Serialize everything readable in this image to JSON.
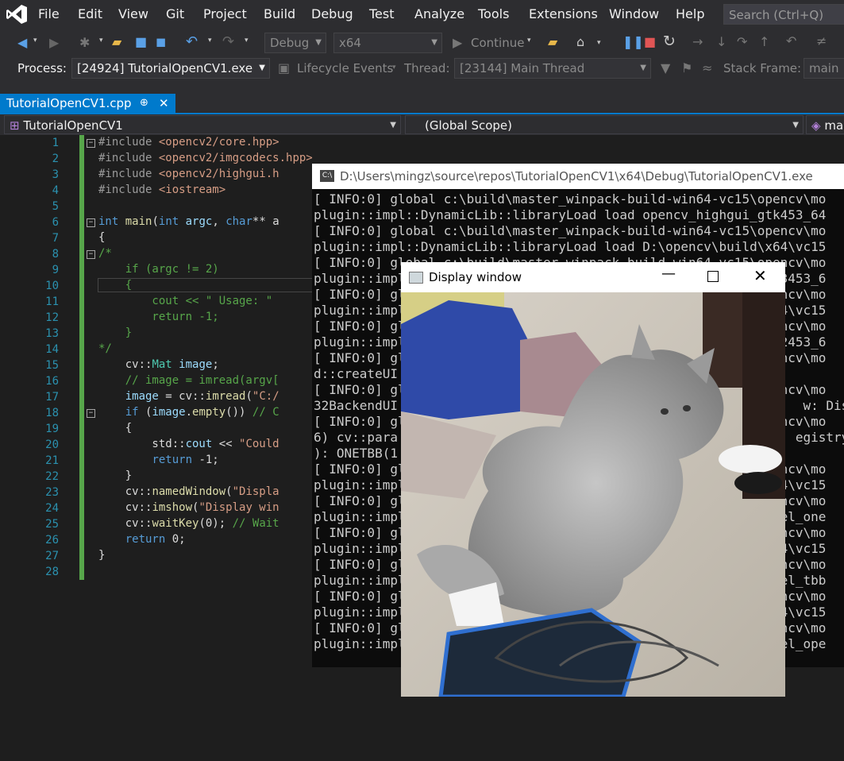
{
  "menubar": {
    "items": [
      "File",
      "Edit",
      "View",
      "Git",
      "Project",
      "Build",
      "Debug",
      "Test",
      "Analyze",
      "Tools",
      "Extensions",
      "Window",
      "Help"
    ],
    "search_placeholder": "Search (Ctrl+Q)"
  },
  "toolbar1": {
    "config": "Debug",
    "platform": "x64",
    "continue_label": "Continue"
  },
  "toolbar2": {
    "process_label": "Process:",
    "process_value": "[24924] TutorialOpenCV1.exe",
    "lifecycle_label": "Lifecycle Events",
    "thread_label": "Thread:",
    "thread_value": "[23144] Main Thread",
    "stackframe_label": "Stack Frame:",
    "stackframe_value": "main"
  },
  "tab": {
    "title": "TutorialOpenCV1.cpp",
    "pin": "⊕",
    "close": "✕"
  },
  "navbar": {
    "project": "TutorialOpenCV1",
    "scope": "(Global Scope)",
    "member": "ma"
  },
  "editor": {
    "line_numbers": [
      "1",
      "2",
      "3",
      "4",
      "5",
      "6",
      "7",
      "8",
      "9",
      "10",
      "11",
      "12",
      "13",
      "14",
      "15",
      "16",
      "17",
      "18",
      "19",
      "20",
      "21",
      "22",
      "23",
      "24",
      "25",
      "26",
      "27",
      "28"
    ]
  },
  "console": {
    "title": "D:\\Users\\mingz\\source\\repos\\TutorialOpenCV1\\x64\\Debug\\TutorialOpenCV1.exe",
    "lines": [
      "[ INFO:0] global c:\\build\\master_winpack-build-win64-vc15\\opencv\\mo",
      "plugin::impl::DynamicLib::libraryLoad load opencv_highgui_gtk453_64",
      "[ INFO:0] global c:\\build\\master_winpack-build-win64-vc15\\opencv\\mo",
      "plugin::impl::DynamicLib::libraryLoad load D:\\opencv\\build\\x64\\vc15",
      "[ INFO:0] global c:\\build\\master_winpack-build-win64-vc15\\opencv\\mo",
      "plugin::impl::DynamicLib::libraryLoad load opencv_highgui_gtk3453_6",
      "[ INFO:0] global c:\\build\\master_winpack-build-win64-vc15\\opencv\\mo",
      "plugin::impl::DynamicLib::libraryLoad load D:\\opencv\\build\\x64\\vc15",
      "[ INFO:0] global c:\\build\\master_winpack-build-win64-vc15\\opencv\\mo",
      "plugin::impl::DynamicLib::libraryLoad load opencv_highgui_gtk2453_6",
      "[ INFO:0] global c:\\build\\master_winpack-build-win64-vc15\\opencv\\mo",
      "d::createUI",
      "[ INFO:0] global c:\\build\\master_winpack-build-win64-vc15\\opencv\\mo",
      "32BackendUI                                                     w: Displ",
      "[ INFO:0] global c:\\build\\master_winpack-build-win64-vc15\\opencv\\mo",
      "6) cv::para                                                    egistry c",
      "): ONETBB(1",
      "[ INFO:0] global c:\\build\\master_winpack-build-win64-vc15\\opencv\\mo",
      "plugin::impl::DynamicLib::libraryLoad load D:\\opencv\\build\\x64\\vc15",
      "[ INFO:0] global c:\\build\\master_winpack-build-win64-vc15\\opencv\\mo",
      "plugin::impl::DynamicLib::libraryLoad load opencv_core_parallel_one",
      "[ INFO:0] global c:\\build\\master_winpack-build-win64-vc15\\opencv\\mo",
      "plugin::impl::DynamicLib::libraryLoad load D:\\opencv\\build\\x64\\vc15",
      "[ INFO:0] global c:\\build\\master_winpack-build-win64-vc15\\opencv\\mo",
      "plugin::impl::DynamicLib::libraryLoad load opencv_core_parallel_tbb",
      "[ INFO:0] global c:\\build\\master_winpack-build-win64-vc15\\opencv\\mo",
      "plugin::impl::DynamicLib::libraryLoad load D:\\opencv\\build\\x64\\vc15",
      "[ INFO:0] global c:\\build\\master_winpack-build-win64-vc15\\opencv\\mo",
      "plugin::impl::DynamicLib::libraryLoad load opencv_core_parallel_ope"
    ]
  },
  "display_window": {
    "title": "Display window"
  },
  "colors": {
    "accent": "#007acc",
    "background": "#1e1e1e",
    "chrome": "#2d2d30",
    "change_bar": "#57a64a"
  }
}
